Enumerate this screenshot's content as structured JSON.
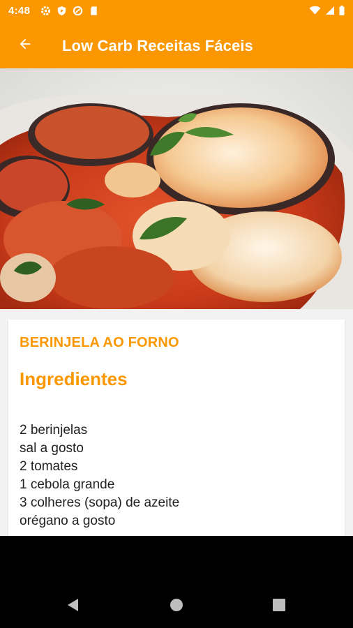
{
  "status_bar": {
    "time": "4:48",
    "left_icons": [
      "gear-icon",
      "play-protect-icon",
      "data-saver-icon",
      "sd-card-icon"
    ],
    "right_icons": [
      "wifi-icon",
      "cell-signal-icon",
      "battery-icon"
    ]
  },
  "app_bar": {
    "title": "Low Carb Receitas Fáceis",
    "back_icon": "arrow-left-icon"
  },
  "recipe": {
    "name": "BERINJELA AO FORNO",
    "section_heading": "Ingredientes",
    "ingredients": [
      "2 berinjelas",
      "sal a gosto",
      "2 tomates",
      "1 cebola grande",
      "3 colheres (sopa) de azeite",
      "orégano a gosto"
    ]
  },
  "nav_bar": {
    "buttons": [
      "back-triangle-icon",
      "home-circle-icon",
      "recents-square-icon"
    ]
  },
  "colors": {
    "accent": "#fb9700",
    "text": "#222222"
  }
}
